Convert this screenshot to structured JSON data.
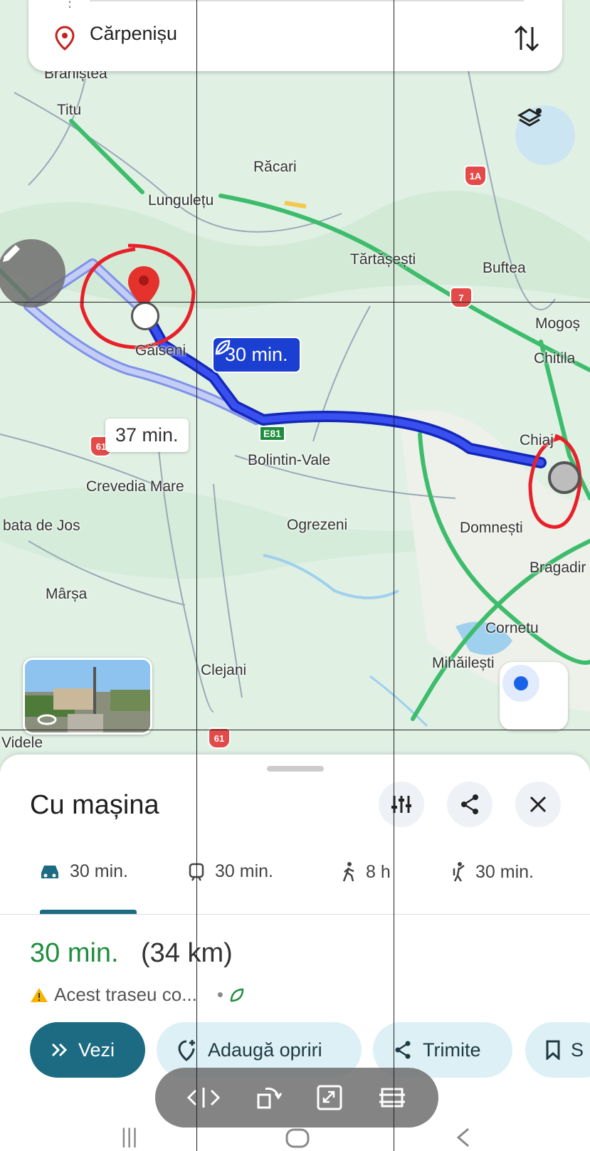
{
  "search": {
    "destination": "Cărpenișu"
  },
  "map": {
    "places": [
      {
        "id": "branistea",
        "name": "Braniștea"
      },
      {
        "id": "titu",
        "name": "Titu"
      },
      {
        "id": "racari",
        "name": "Răcari"
      },
      {
        "id": "lunguletu",
        "name": "Lungulețu"
      },
      {
        "id": "tartasesti",
        "name": "Tărtășești"
      },
      {
        "id": "buftea",
        "name": "Buftea"
      },
      {
        "id": "mogos",
        "name": "Mogoș"
      },
      {
        "id": "chitila",
        "name": "Chitila"
      },
      {
        "id": "gaiseni",
        "name": "Găiseni"
      },
      {
        "id": "chiajna",
        "name": "Chiaj"
      },
      {
        "id": "bolintin",
        "name": "Bolintin-Vale"
      },
      {
        "id": "crevedia",
        "name": "Crevedia Mare"
      },
      {
        "id": "ogrezeni",
        "name": "Ogrezeni"
      },
      {
        "id": "domnesti",
        "name": "Domnești"
      },
      {
        "id": "bata",
        "name": "bata de Jos"
      },
      {
        "id": "bragadiru",
        "name": "Bragadir"
      },
      {
        "id": "marsa",
        "name": "Mârșa"
      },
      {
        "id": "cornetu",
        "name": "Cornetu"
      },
      {
        "id": "mihailesti",
        "name": "Mihăilești"
      },
      {
        "id": "clejani",
        "name": "Clejani"
      },
      {
        "id": "videle",
        "name": "Videle"
      }
    ],
    "road_shields": {
      "a1": "1A",
      "dn7": "7",
      "dn61a": "61",
      "dn61b": "61",
      "e81": "E81"
    },
    "fast_route_time": "30 min.",
    "alt_route_time": "37 min.",
    "colors": {
      "route_primary": "#1a3fd1",
      "route_alt": "#a9b7f2",
      "highway": "#3dbd6c",
      "annotation": "#e8202a"
    }
  },
  "sheet": {
    "title": "Cu mașina",
    "modes": [
      {
        "icon": "car-icon",
        "label": "30 min."
      },
      {
        "icon": "transit-icon",
        "label": "30 min."
      },
      {
        "icon": "walk-icon",
        "label": "8 h"
      },
      {
        "icon": "ride-icon",
        "label": "30 min."
      }
    ],
    "route_time": "30 min.",
    "route_distance": "(34 km)",
    "route_warning": "Acest traseu co...",
    "actions": {
      "go": "Vezi",
      "add_stops": "Adaugă opriri",
      "share": "Trimite",
      "save": "S"
    }
  }
}
